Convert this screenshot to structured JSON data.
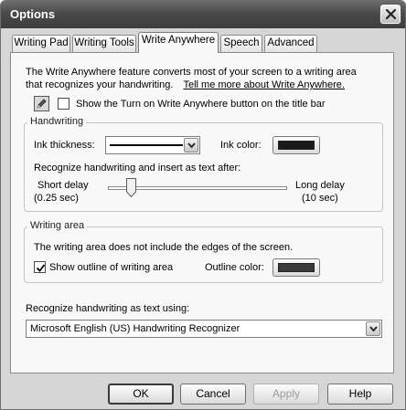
{
  "window": {
    "title": "Options"
  },
  "tabs": [
    {
      "label": "Writing Pad"
    },
    {
      "label": "Writing Tools"
    },
    {
      "label": "Write Anywhere"
    },
    {
      "label": "Speech"
    },
    {
      "label": "Advanced"
    }
  ],
  "active_tab": "Write Anywhere",
  "intro": {
    "line1": "The Write Anywhere feature converts most of your screen to a writing area",
    "line2": "that recognizes your handwriting.",
    "link": "Tell me more about Write Anywhere."
  },
  "title_bar_option": {
    "label": "Show the Turn on Write Anywhere button on the title bar",
    "checked": false,
    "icon": "pen-icon"
  },
  "handwriting": {
    "group_label": "Handwriting",
    "ink_thickness_label": "Ink thickness:",
    "ink_color_label": "Ink color:",
    "ink_color": "#1a1a1a",
    "recognize_label": "Recognize handwriting and insert as text after:",
    "short_delay_label": "Short delay",
    "short_delay_value": "(0.25 sec)",
    "long_delay_label": "Long delay",
    "long_delay_value": "(10 sec)",
    "slider_position": 0.13
  },
  "writing_area": {
    "group_label": "Writing area",
    "note": "The writing area does not include the edges of the screen.",
    "show_outline_label": "Show outline of writing area",
    "show_outline_checked": true,
    "outline_color_label": "Outline color:",
    "outline_color": "#3a3a3a"
  },
  "recognizer": {
    "label": "Recognize handwriting as text using:",
    "selected": "Microsoft English (US) Handwriting Recognizer"
  },
  "buttons": {
    "ok": "OK",
    "cancel": "Cancel",
    "apply": "Apply",
    "help": "Help"
  }
}
